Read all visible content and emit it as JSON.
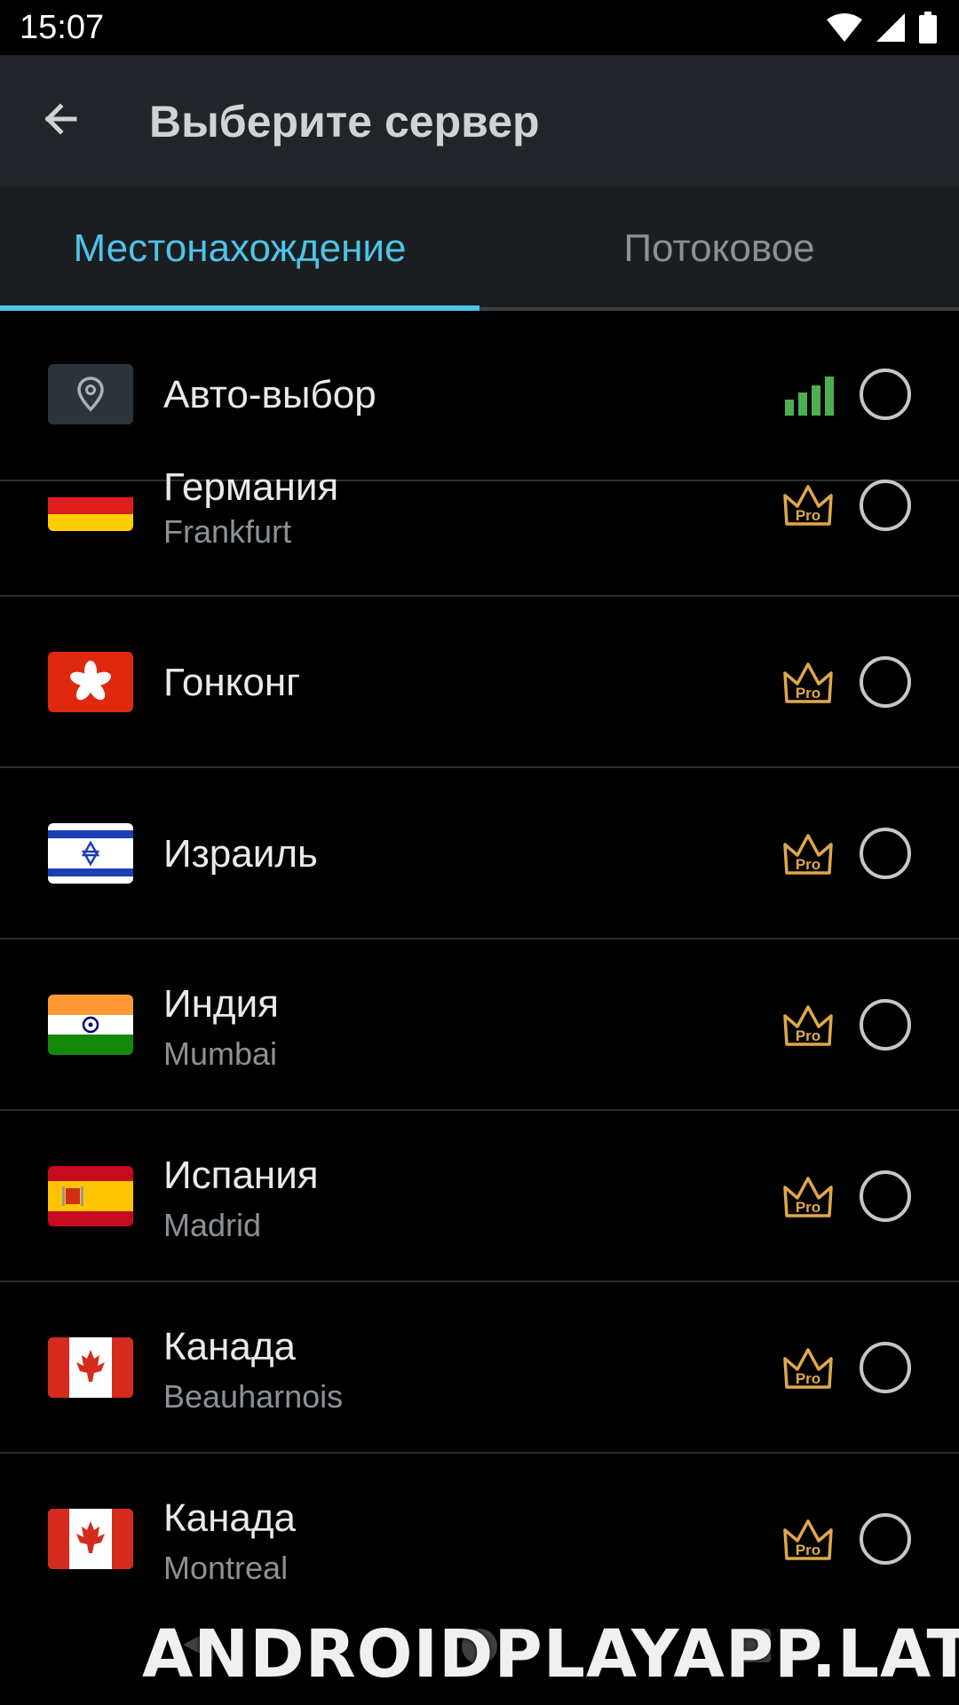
{
  "status_bar": {
    "time": "15:07"
  },
  "toolbar": {
    "title": "Выберите сервер"
  },
  "tabs": [
    {
      "label": "Местонахождение",
      "selected": true
    },
    {
      "label": "Потоковое",
      "selected": false
    }
  ],
  "auto": {
    "label": "Авто-выбор"
  },
  "servers": [
    {
      "country": "Германия",
      "city": "Frankfurt",
      "flag": "germany"
    },
    {
      "country": "Гонконг",
      "city": "",
      "flag": "hong-kong"
    },
    {
      "country": "Израиль",
      "city": "",
      "flag": "israel"
    },
    {
      "country": "Индия",
      "city": "Mumbai",
      "flag": "india"
    },
    {
      "country": "Испания",
      "city": "Madrid",
      "flag": "spain"
    },
    {
      "country": "Канада",
      "city": "Beauharnois",
      "flag": "canada"
    },
    {
      "country": "Канада",
      "city": "Montreal",
      "flag": "canada"
    }
  ],
  "pro_badge": "Pro",
  "watermark": "ANDROIDPLAYAPP.LAT",
  "colors": {
    "accent": "#4fc3e8",
    "pro_gold": "#e0a84a",
    "signal_green": "#4caf50"
  }
}
